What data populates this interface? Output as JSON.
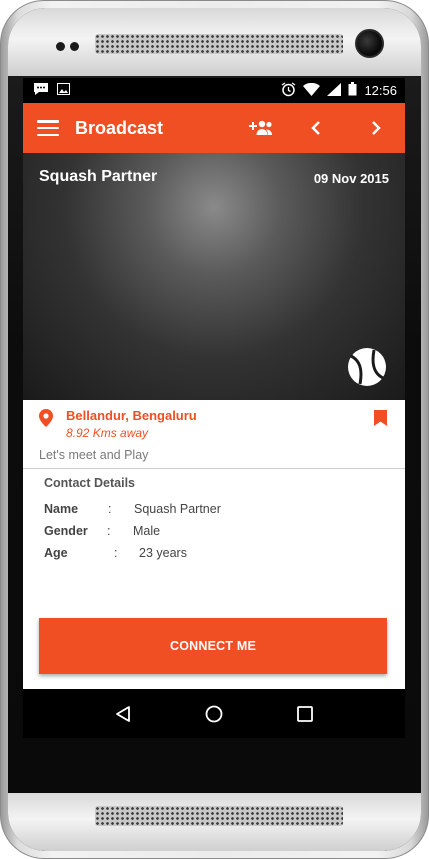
{
  "status_bar": {
    "time": "12:56"
  },
  "app_bar": {
    "title": "Broadcast"
  },
  "post": {
    "title": "Squash Partner",
    "date": "09 Nov 2015",
    "location": "Bellandur, Bengaluru",
    "distance": "8.92 Kms away",
    "tagline": "Let's meet and Play"
  },
  "contact": {
    "heading": "Contact Details",
    "separator": ":",
    "rows": [
      {
        "label": "Name",
        "value": "Squash Partner"
      },
      {
        "label": "Gender",
        "value": "Male"
      },
      {
        "label": "Age",
        "value": "23 years"
      }
    ]
  },
  "connect_button": {
    "label": "CONNECT ME"
  },
  "icons": {
    "menu": "hamburger-menu-icon",
    "group": "add-group-icon",
    "prev": "chevron-left-icon",
    "next": "chevron-right-icon",
    "sport": "tennis-ball-icon",
    "location": "map-pin-icon",
    "bookmark": "bookmark-icon",
    "nav_back": "triangle-back-icon",
    "nav_home": "circle-home-icon",
    "nav_recents": "square-recents-icon"
  },
  "colors": {
    "accent": "#f04e23",
    "statusbar": "#000000",
    "navbar": "#000000"
  }
}
